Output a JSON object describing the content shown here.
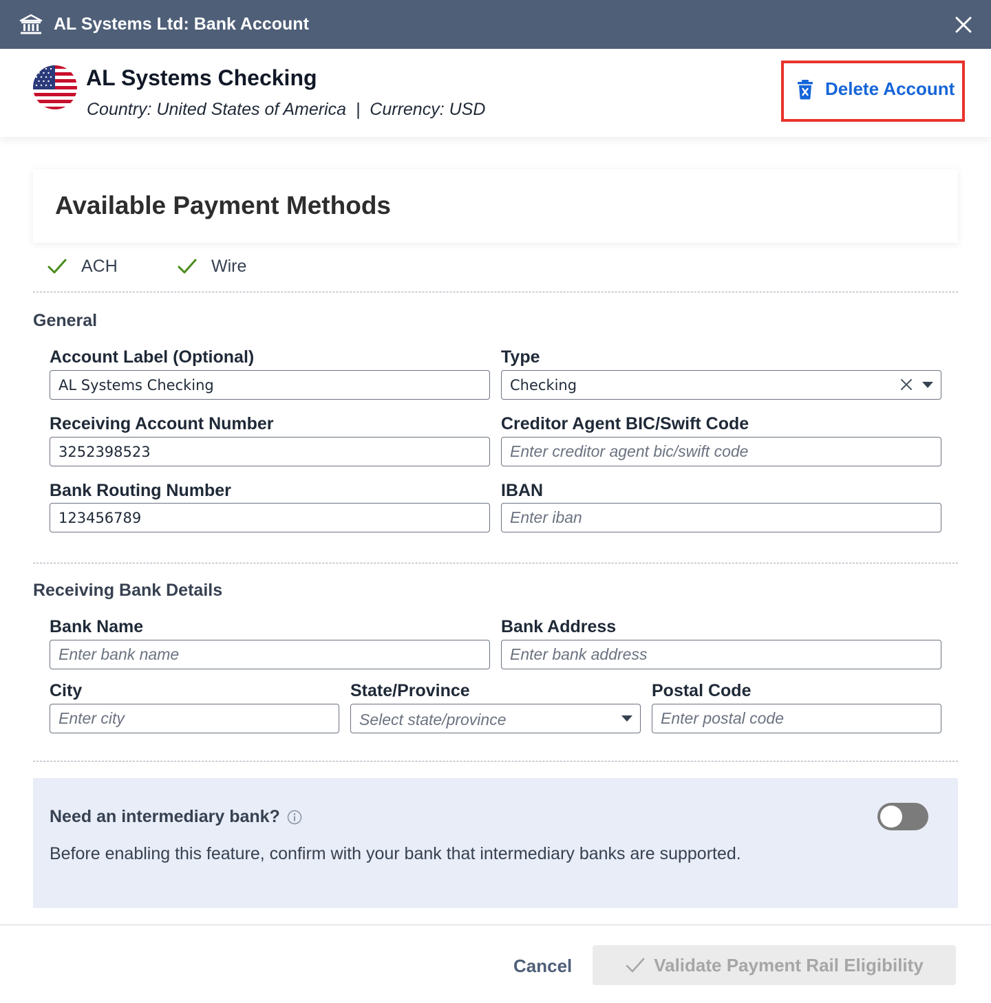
{
  "window": {
    "title": "AL Systems Ltd: Bank Account",
    "icon": "bank-icon",
    "close_icon": "close-icon"
  },
  "header": {
    "account_name": "AL Systems Checking",
    "country_line": "Country: United States of America  |  Currency: USD",
    "flag": "us-flag-icon",
    "delete_label": "Delete Account",
    "delete_icon": "trash-icon",
    "colors": {
      "delete_text": "#1565d8",
      "highlight_border": "#e8332c"
    }
  },
  "payment_methods": {
    "title": "Available Payment Methods",
    "methods": [
      {
        "label": "ACH",
        "icon": "check-icon",
        "enabled": true
      },
      {
        "label": "Wire",
        "icon": "check-icon",
        "enabled": true
      }
    ],
    "check_color": "#4a8c1c"
  },
  "general": {
    "section_title": "General",
    "account_label": {
      "label": "Account Label (Optional)",
      "value": "AL Systems Checking",
      "placeholder": ""
    },
    "type": {
      "label": "Type",
      "value": "Checking"
    },
    "account_number": {
      "label": "Receiving Account Number",
      "value": "3252398523",
      "placeholder": ""
    },
    "bic": {
      "label": "Creditor Agent BIC/Swift Code",
      "value": "",
      "placeholder": "Enter creditor agent bic/swift code"
    },
    "routing": {
      "label": "Bank Routing Number",
      "value": "123456789",
      "placeholder": ""
    },
    "iban": {
      "label": "IBAN",
      "value": "",
      "placeholder": "Enter iban"
    }
  },
  "bank_details": {
    "section_title": "Receiving Bank Details",
    "bank_name": {
      "label": "Bank Name",
      "placeholder": "Enter bank name"
    },
    "bank_address": {
      "label": "Bank Address",
      "placeholder": "Enter bank address"
    },
    "city": {
      "label": "City",
      "placeholder": "Enter city"
    },
    "state": {
      "label": "State/Province",
      "placeholder": "Select state/province"
    },
    "postal": {
      "label": "Postal Code",
      "placeholder": "Enter postal code"
    }
  },
  "intermediary": {
    "question": "Need an intermediary bank?",
    "description": "Before enabling this feature, confirm with your bank that intermediary banks are supported.",
    "toggle_on": false,
    "background": "#e8edf7"
  },
  "footer": {
    "cancel_label": "Cancel",
    "validate_label": "Validate Payment Rail Eligibility",
    "validate_enabled": false
  }
}
